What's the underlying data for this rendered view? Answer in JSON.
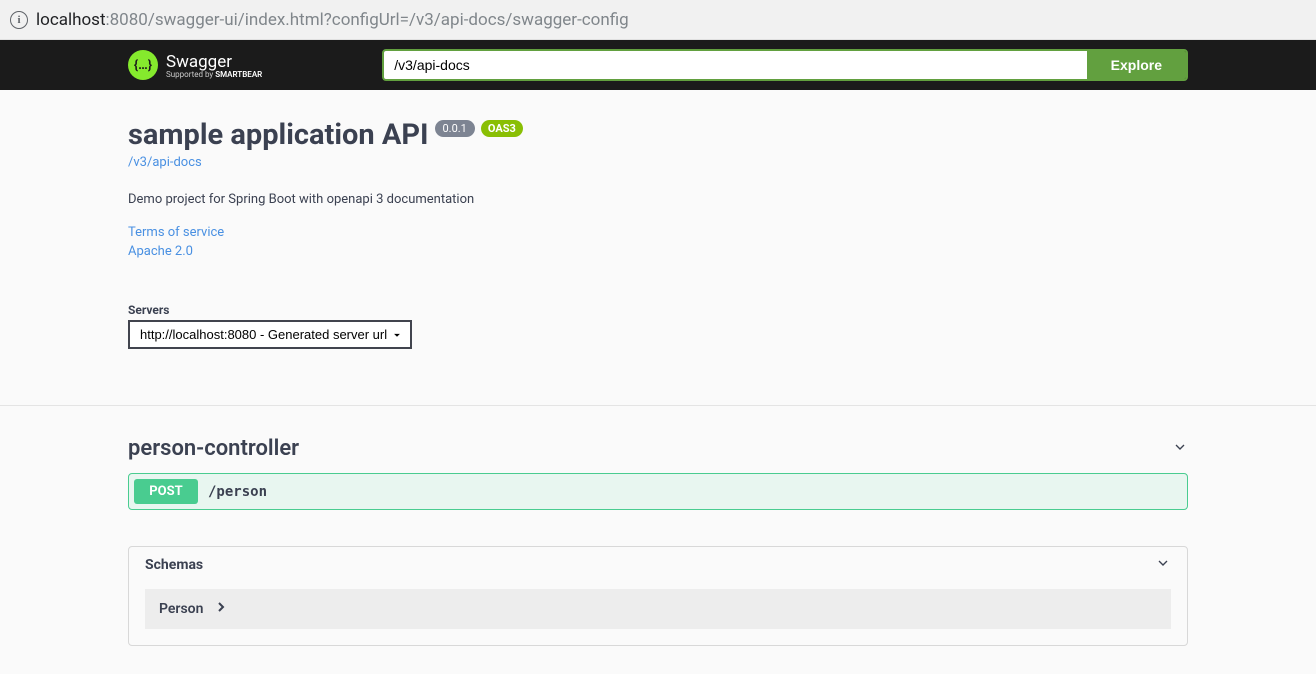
{
  "browser": {
    "url_host": "localhost",
    "url_port": ":8080",
    "url_path": "/swagger-ui/index.html?configUrl=/v3/api-docs/swagger-config"
  },
  "topbar": {
    "brand_main": "Swagger",
    "brand_sub_prefix": "Supported by ",
    "brand_sub_bold": "SMARTBEAR",
    "spec_input": "/v3/api-docs",
    "explore_label": "Explore"
  },
  "info": {
    "title": "sample application API",
    "version": "0.0.1",
    "oas": "OAS3",
    "docs_url": "/v3/api-docs",
    "description": "Demo project for Spring Boot with openapi 3 documentation",
    "terms_label": "Terms of service",
    "license_label": "Apache 2.0"
  },
  "servers": {
    "label": "Servers",
    "selected": "http://localhost:8080 - Generated server url"
  },
  "tag": {
    "name": "person-controller"
  },
  "operation": {
    "method": "POST",
    "path": "/person"
  },
  "schemas": {
    "header": "Schemas",
    "item_name": "Person"
  }
}
